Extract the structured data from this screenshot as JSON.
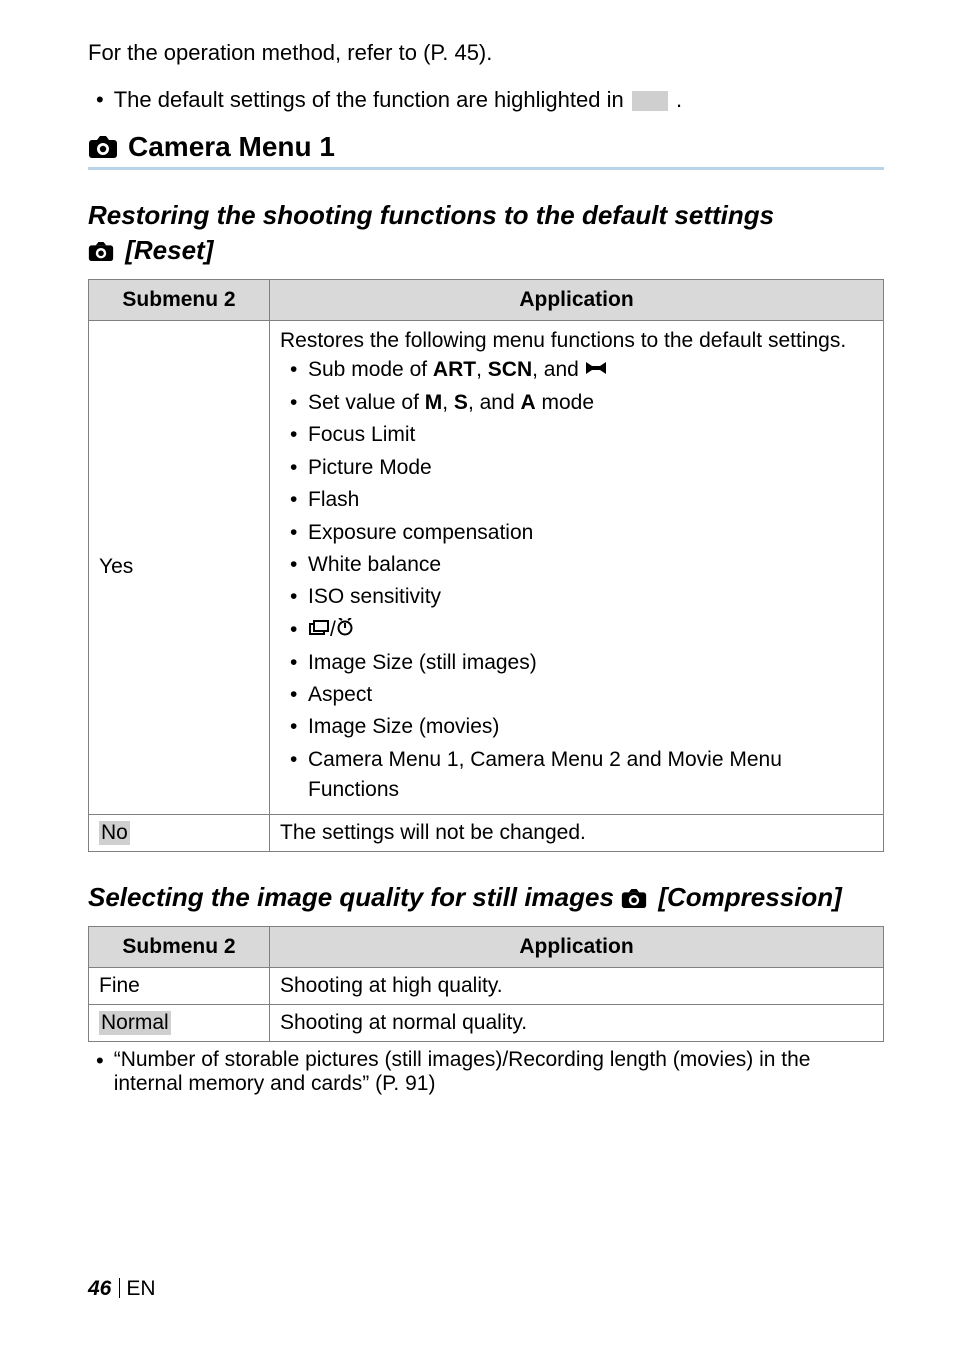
{
  "intro": {
    "operation_ref": "For the operation method, refer to (P. 45).",
    "default_highlight_pre": "The default settings of the function are highlighted in ",
    "default_highlight_post": "."
  },
  "section": {
    "title": "Camera Menu 1",
    "icon_name": "camera-icon"
  },
  "reset": {
    "heading_line1": "Restoring the shooting functions to the default settings",
    "heading_line2": " [Reset]",
    "table": {
      "headers": {
        "col1": "Submenu 2",
        "col2": "Application"
      },
      "yes": {
        "label": "Yes",
        "lead": "Restores the following menu functions to the default settings.",
        "items": [
          {
            "text_pre": "Sub mode of ",
            "modes": [
              "ART",
              "SCN"
            ],
            "text_mid": ", ",
            "text_and": ", and ",
            "trailing_icon": "panorama-icon"
          },
          {
            "text_pre": "Set value of ",
            "modes": [
              "M",
              "S",
              "A"
            ],
            "text_mid": ", ",
            "text_and": ", and ",
            "text_post": " mode"
          },
          {
            "text": "Focus Limit"
          },
          {
            "text": "Picture Mode"
          },
          {
            "text": "Flash"
          },
          {
            "text": "Exposure compensation"
          },
          {
            "text": "White balance"
          },
          {
            "text": "ISO sensitivity"
          },
          {
            "icons": [
              "drive-mode-icon",
              "self-timer-icon"
            ],
            "sep": "/"
          },
          {
            "text": "Image Size (still images)"
          },
          {
            "text": "Aspect"
          },
          {
            "text": "Image Size (movies)"
          },
          {
            "text": "Camera Menu 1, Camera Menu 2 and Movie Menu Functions"
          }
        ]
      },
      "no": {
        "label": "No",
        "text": "The settings will not be changed."
      }
    }
  },
  "compression": {
    "heading_pre": "Selecting the image quality for still images ",
    "heading_post": " [Compression]",
    "table": {
      "headers": {
        "col1": "Submenu 2",
        "col2": "Application"
      },
      "rows": [
        {
          "label": "Fine",
          "text": "Shooting at high quality."
        },
        {
          "label": "Normal",
          "text": "Shooting at normal quality.",
          "default": true
        }
      ]
    },
    "footnote": "“Number of storable pictures (still images)/Recording length (movies) in the internal memory and cards” (P. 91)"
  },
  "footer": {
    "page_number": "46",
    "lang": "EN"
  }
}
